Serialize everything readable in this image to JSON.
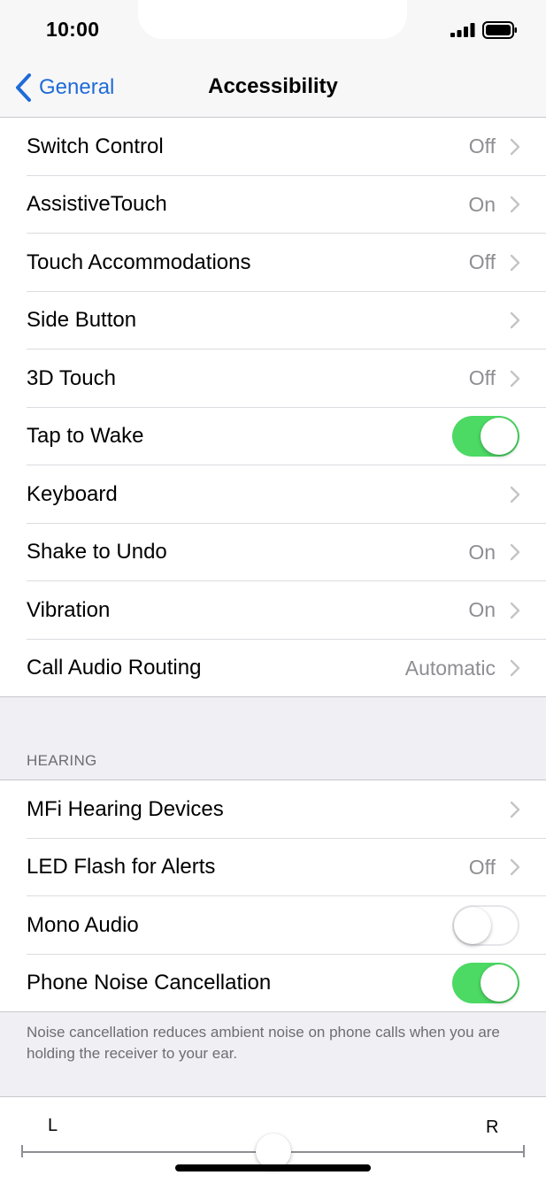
{
  "status_bar": {
    "time": "10:00",
    "signal_icon": "cellular-signal-icon",
    "battery_icon": "battery-full-icon"
  },
  "nav": {
    "back_label": "General",
    "title": "Accessibility",
    "back_icon": "chevron-left-icon"
  },
  "interaction_rows": [
    {
      "label": "Switch Control",
      "value": "Off",
      "type": "disclosure"
    },
    {
      "label": "AssistiveTouch",
      "value": "On",
      "type": "disclosure"
    },
    {
      "label": "Touch Accommodations",
      "value": "Off",
      "type": "disclosure"
    },
    {
      "label": "Side Button",
      "value": "",
      "type": "disclosure"
    },
    {
      "label": "3D Touch",
      "value": "Off",
      "type": "disclosure"
    },
    {
      "label": "Tap to Wake",
      "type": "toggle",
      "on": true
    },
    {
      "label": "Keyboard",
      "value": "",
      "type": "disclosure"
    },
    {
      "label": "Shake to Undo",
      "value": "On",
      "type": "disclosure"
    },
    {
      "label": "Vibration",
      "value": "On",
      "type": "disclosure"
    },
    {
      "label": "Call Audio Routing",
      "value": "Automatic",
      "type": "disclosure"
    }
  ],
  "hearing": {
    "header": "HEARING",
    "rows": [
      {
        "label": "MFi Hearing Devices",
        "value": "",
        "type": "disclosure"
      },
      {
        "label": "LED Flash for Alerts",
        "value": "Off",
        "type": "disclosure"
      },
      {
        "label": "Mono Audio",
        "type": "toggle",
        "on": false
      },
      {
        "label": "Phone Noise Cancellation",
        "type": "toggle",
        "on": true
      }
    ],
    "footer": "Noise cancellation reduces ambient noise on phone calls when you are holding the receiver to your ear."
  },
  "balance": {
    "left_label": "L",
    "right_label": "R",
    "position": 0.5
  },
  "colors": {
    "accent": "#1f6bd8",
    "toggle_on": "#4cd964",
    "secondary_text": "#8e8e93",
    "background": "#efeff4"
  }
}
